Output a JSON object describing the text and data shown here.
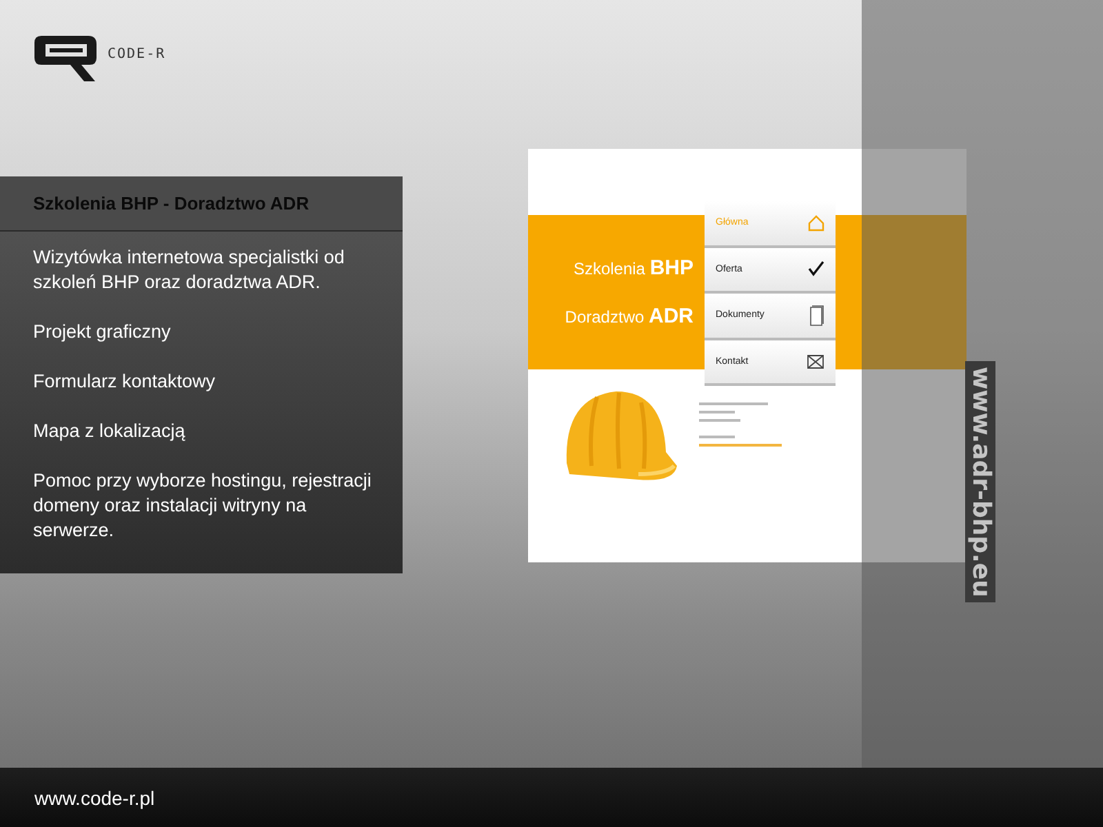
{
  "logo": {
    "text": "CODE-R"
  },
  "project": {
    "title": "Szkolenia BHP - Doradztwo ADR",
    "features": [
      "Wizytówka internetowa specjalistki od szkoleń BHP oraz doradztwa ADR.",
      "Projekt graficzny",
      "Formularz kontaktowy",
      "Mapa z lokalizacją",
      "Pomoc przy wyborze hostingu, rejestracji domeny oraz instalacji witryny na serwerze."
    ]
  },
  "mockup": {
    "headlines": [
      "Szkolenia **BHP**",
      "Doradztwo **ADR**"
    ],
    "nav": [
      {
        "label": "Główna",
        "kind": "home",
        "selected": true
      },
      {
        "label": "Oferta",
        "kind": "check",
        "selected": false
      },
      {
        "label": "Dokumenty",
        "kind": "document",
        "selected": false
      },
      {
        "label": "Kontakt",
        "kind": "mail",
        "selected": false
      }
    ]
  },
  "site_url": "www.adr-bhp.eu",
  "footer": {
    "url": "www.code-r.pl"
  }
}
